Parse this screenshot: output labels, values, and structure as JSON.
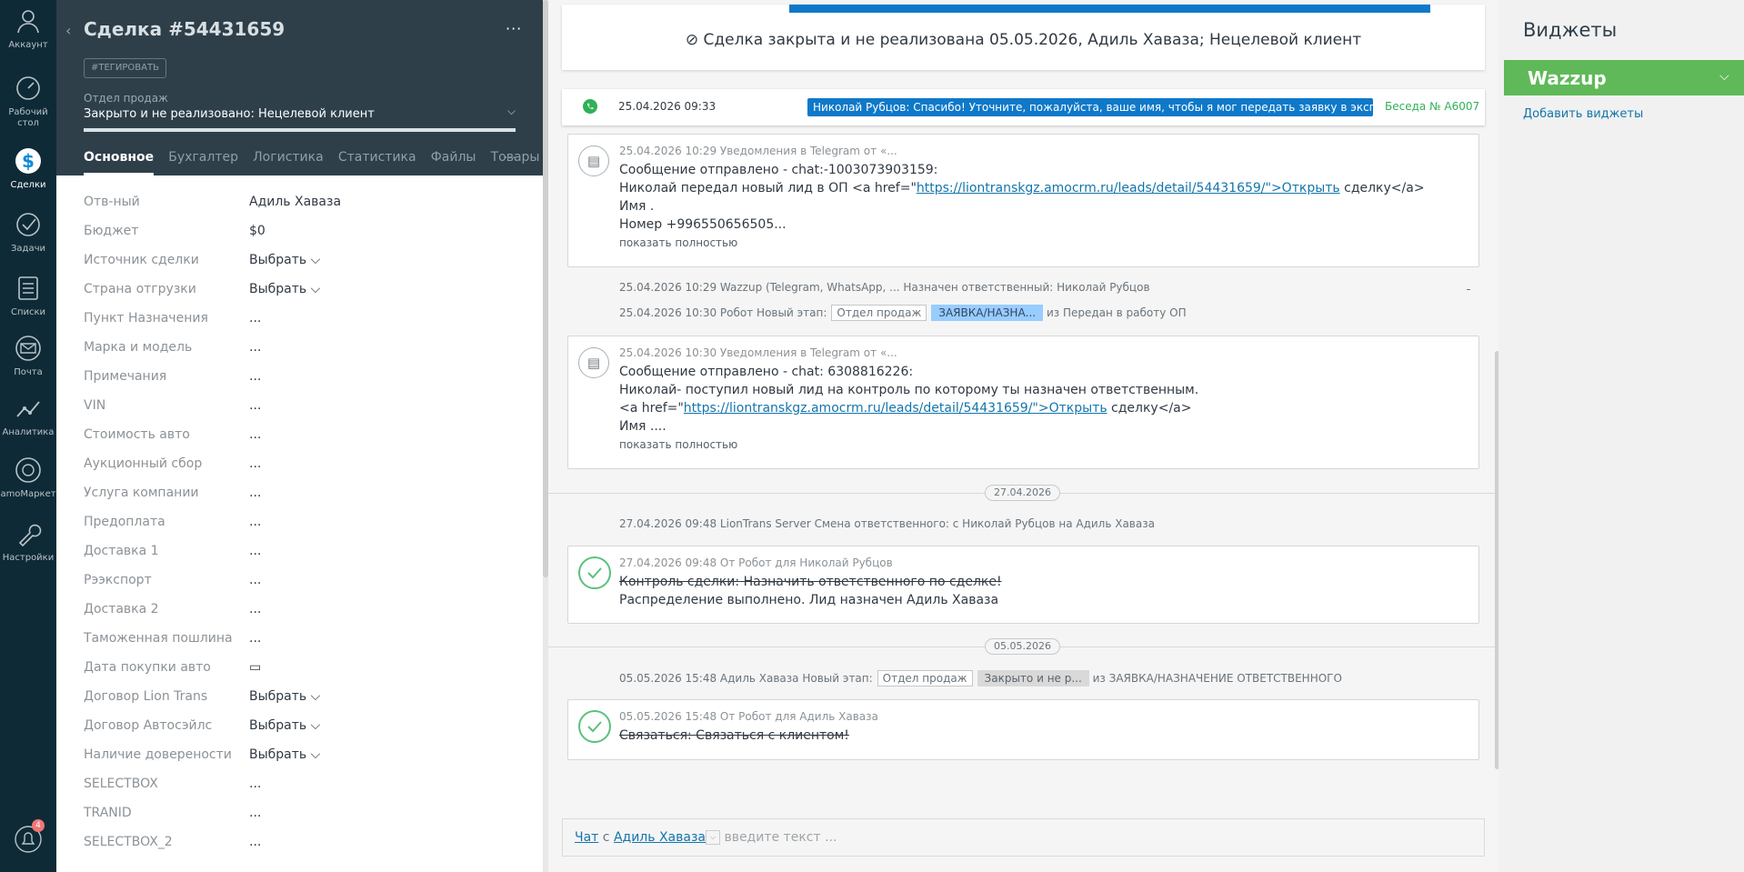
{
  "nav": {
    "items": [
      {
        "label": "Аккаунт"
      },
      {
        "label": "Рабочий стол"
      },
      {
        "label": "Сделки"
      },
      {
        "label": "Задачи"
      },
      {
        "label": "Списки"
      },
      {
        "label": "Почта"
      },
      {
        "label": "Аналитика"
      },
      {
        "label": "amoМаркет"
      },
      {
        "label": "Настройки"
      }
    ],
    "notifications_badge": "4"
  },
  "card": {
    "title": "Сделка #54431659",
    "more": "···",
    "tag_button": "#ТЕГИРОВАТЬ",
    "pipeline_label": "Отдел продаж",
    "pipeline_status": "Закрыто и не реализовано: Нецелевой клиент",
    "tabs": [
      "Основное",
      "Бухгалтер",
      "Логистика",
      "Статистика",
      "Файлы",
      "Товары"
    ],
    "tabs_more": "···",
    "fields": [
      {
        "label": "Отв-ный",
        "value": "Адиль Хаваза"
      },
      {
        "label": "Бюджет",
        "value": "$0"
      },
      {
        "label": "Источник сделки",
        "value": "Выбрать ⌵"
      },
      {
        "label": "Страна отгрузки",
        "value": "Выбрать ⌵"
      },
      {
        "label": "Пункт Назначения",
        "value": "..."
      },
      {
        "label": "Марка и модель",
        "value": "..."
      },
      {
        "label": "Примечания",
        "value": "..."
      },
      {
        "label": "VIN",
        "value": "..."
      },
      {
        "label": "Стоимость авто",
        "value": "..."
      },
      {
        "label": "Аукционный сбор",
        "value": "..."
      },
      {
        "label": "Услуга компании",
        "value": "..."
      },
      {
        "label": "Предоплата",
        "value": "..."
      },
      {
        "label": "Доставка 1",
        "value": "..."
      },
      {
        "label": "Рээкспорт",
        "value": "..."
      },
      {
        "label": "Доставка 2",
        "value": "..."
      },
      {
        "label": "Таможенная пошлина",
        "value": "..."
      },
      {
        "label": "Дата покупки авто",
        "value": "▭"
      },
      {
        "label": "Договор Lion Trans",
        "value": "Выбрать ⌵"
      },
      {
        "label": "Договор Автосэйлс",
        "value": "Выбрать ⌵"
      },
      {
        "label": "Наличие довереноcти",
        "value": "Выбрать ⌵"
      },
      {
        "label": "SELECTBOX",
        "value": "..."
      },
      {
        "label": "TRANID",
        "value": "..."
      },
      {
        "label": "SELECTBOX_2",
        "value": "..."
      }
    ]
  },
  "feed": {
    "closed_banner": "Сделка закрыта и не реализована 05.05.2026, Адиль Хаваза; Нецелевой клиент",
    "wa_date": "25.04.2026 09:33",
    "wa_message": "Николай Рубцов: Спасибо! Уточните, пожалуйста, ваше имя, чтобы я мог передать заявку в экспертный от...",
    "wa_conversation": "Беседа № А6007",
    "note1_head": "25.04.2026 10:29 Уведомления в Telegram от «...",
    "note1_line1": "Сообщение отправлено - chat:-1003073903159:",
    "note1_line2_pre": "Николай передал новый лид в ОП <a href=\"",
    "note1_link": "https://liontranskgz.amocrm.ru/leads/detail/54431659/\">Открыть",
    "note1_line2_post": " сделку</a>",
    "note1_line3": "Имя .",
    "note1_line4": "Номер +996550656505...",
    "show_full": "показать полностью",
    "sys1": "25.04.2026 10:29 Wazzup (Telegram, WhatsApp, ... Назначен ответственный: Николай Рубцов",
    "sys2_pre": "25.04.2026 10:30 Робот Новый этап:",
    "sys2_pipe": "Отдел продаж",
    "sys2_stage": "ЗАЯВКА/НАЗНА...",
    "sys2_post": "из Передан в работу ОП",
    "note2_head": "25.04.2026 10:30 Уведомления в Telegram от «...",
    "note2_line1": "Сообщение отправлено - chat: 6308816226:",
    "note2_line2": "Николай- поступил новый лид на контроль по которому ты назначен ответственным.",
    "note2_line3_pre": "<a href=\"",
    "note2_link": "https://liontranskgz.amocrm.ru/leads/detail/54431659/\">Открыть",
    "note2_line3_post": " сделку</a>",
    "note2_line4": "Имя ....",
    "date1": "27.04.2026",
    "sys3": "27.04.2026 09:48 LionTrans Server Смена ответственного: с Николай Рубцов на Адиль Хаваза",
    "task1_head": "27.04.2026 09:48  От Робот для Николай Рубцов",
    "task1_line1": "Контроль сделки: Назначить ответственного по сделке!",
    "task1_line2": "Распределение выполнено. Лид назначен Адиль Хаваза",
    "date2": "05.05.2026",
    "sys4_pre": "05.05.2026 15:48 Адиль Хаваза Новый этап:",
    "sys4_pipe": "Отдел продаж",
    "sys4_stage": "Закрыто и не р...",
    "sys4_post": "из ЗАЯВКА/НАЗНАЧЕНИЕ ОТВЕТСТВЕННОГО",
    "task2_head": "05.05.2026 15:48  От Робот для Адиль Хаваза",
    "task2_line1": "Связаться: Связаться с клиентом!",
    "chat_label": "Чат",
    "chat_with": "с",
    "chat_user": "Адиль Хаваза",
    "chat_placeholder": "введите текст ..."
  },
  "widgets": {
    "title": "Виджеты",
    "wazzup": "Wazzup",
    "add": "Добавить виджеты"
  },
  "colors": {
    "nav_bg": "#0e2a36",
    "card_head_bg": "#2e3f4a",
    "wazzup_green": "#5fb958",
    "link_blue": "#1375ab",
    "message_blue": "#0f79c9"
  }
}
